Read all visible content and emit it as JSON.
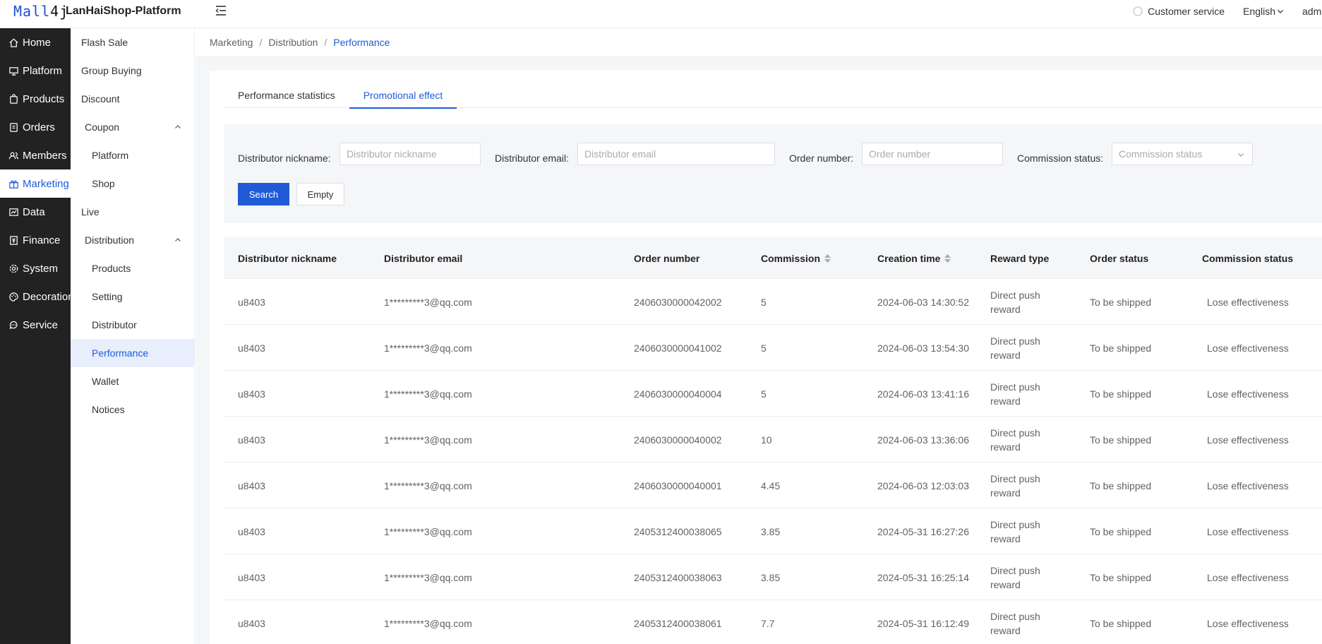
{
  "header": {
    "logo_blue": "Mall",
    "logo_dark": "4j",
    "platform_name": "LanHaiShop-Platform",
    "customer_service": "Customer service",
    "language": "English",
    "user": "admin"
  },
  "sidebar": {
    "items": [
      {
        "label": "Home",
        "icon": "home-icon"
      },
      {
        "label": "Platform",
        "icon": "monitor-icon"
      },
      {
        "label": "Products",
        "icon": "bag-icon"
      },
      {
        "label": "Orders",
        "icon": "order-icon"
      },
      {
        "label": "Members",
        "icon": "members-icon"
      },
      {
        "label": "Marketing",
        "icon": "gift-icon"
      },
      {
        "label": "Data",
        "icon": "chart-icon"
      },
      {
        "label": "Finance",
        "icon": "finance-icon"
      },
      {
        "label": "System",
        "icon": "gear-icon"
      },
      {
        "label": "Decoration",
        "icon": "palette-icon"
      },
      {
        "label": "Service",
        "icon": "chat-icon"
      }
    ]
  },
  "subnav": {
    "items": [
      {
        "label": "Flash Sale"
      },
      {
        "label": "Group Buying"
      },
      {
        "label": "Discount"
      },
      {
        "label": "Coupon"
      },
      {
        "label": "Platform"
      },
      {
        "label": "Shop"
      },
      {
        "label": "Live"
      },
      {
        "label": "Distribution"
      },
      {
        "label": "Products"
      },
      {
        "label": "Setting"
      },
      {
        "label": "Distributor"
      },
      {
        "label": "Performance"
      },
      {
        "label": "Wallet"
      },
      {
        "label": "Notices"
      }
    ]
  },
  "breadcrumb": {
    "items": [
      "Marketing",
      "Distribution",
      "Performance"
    ],
    "separator": "/"
  },
  "tabs": [
    {
      "label": "Performance statistics"
    },
    {
      "label": "Promotional effect"
    }
  ],
  "filters": {
    "nickname_label": "Distributor nickname:",
    "nickname_placeholder": "Distributor nickname",
    "email_label": "Distributor email:",
    "email_placeholder": "Distributor email",
    "order_label": "Order number:",
    "order_placeholder": "Order number",
    "status_label": "Commission status:",
    "status_placeholder": "Commission status",
    "search_label": "Search",
    "empty_label": "Empty"
  },
  "table": {
    "headers": [
      "Distributor nickname",
      "Distributor email",
      "Order number",
      "Commission",
      "Creation time",
      "Reward type",
      "Order status",
      "Commission status"
    ],
    "rows": [
      {
        "nickname": "u8403",
        "email": "1*********3@qq.com",
        "order": "2406030000042002",
        "commission": "5",
        "time": "2024-06-03 14:30:52",
        "reward": "Direct push reward",
        "order_status": "To be shipped",
        "commission_status": "Lose effectiveness"
      },
      {
        "nickname": "u8403",
        "email": "1*********3@qq.com",
        "order": "2406030000041002",
        "commission": "5",
        "time": "2024-06-03 13:54:30",
        "reward": "Direct push reward",
        "order_status": "To be shipped",
        "commission_status": "Lose effectiveness"
      },
      {
        "nickname": "u8403",
        "email": "1*********3@qq.com",
        "order": "2406030000040004",
        "commission": "5",
        "time": "2024-06-03 13:41:16",
        "reward": "Direct push reward",
        "order_status": "To be shipped",
        "commission_status": "Lose effectiveness"
      },
      {
        "nickname": "u8403",
        "email": "1*********3@qq.com",
        "order": "2406030000040002",
        "commission": "10",
        "time": "2024-06-03 13:36:06",
        "reward": "Direct push reward",
        "order_status": "To be shipped",
        "commission_status": "Lose effectiveness"
      },
      {
        "nickname": "u8403",
        "email": "1*********3@qq.com",
        "order": "2406030000040001",
        "commission": "4.45",
        "time": "2024-06-03 12:03:03",
        "reward": "Direct push reward",
        "order_status": "To be shipped",
        "commission_status": "Lose effectiveness"
      },
      {
        "nickname": "u8403",
        "email": "1*********3@qq.com",
        "order": "2405312400038065",
        "commission": "3.85",
        "time": "2024-05-31 16:27:26",
        "reward": "Direct push reward",
        "order_status": "To be shipped",
        "commission_status": "Lose effectiveness"
      },
      {
        "nickname": "u8403",
        "email": "1*********3@qq.com",
        "order": "2405312400038063",
        "commission": "3.85",
        "time": "2024-05-31 16:25:14",
        "reward": "Direct push reward",
        "order_status": "To be shipped",
        "commission_status": "Lose effectiveness"
      },
      {
        "nickname": "u8403",
        "email": "1*********3@qq.com",
        "order": "2405312400038061",
        "commission": "7.7",
        "time": "2024-05-31 16:12:49",
        "reward": "Direct push reward",
        "order_status": "To be shipped",
        "commission_status": "Lose effectiveness"
      }
    ]
  },
  "colors": {
    "accent": "#1f5bd6",
    "sidebar_bg": "#222222",
    "active_sub_bg": "#e8eefb"
  }
}
